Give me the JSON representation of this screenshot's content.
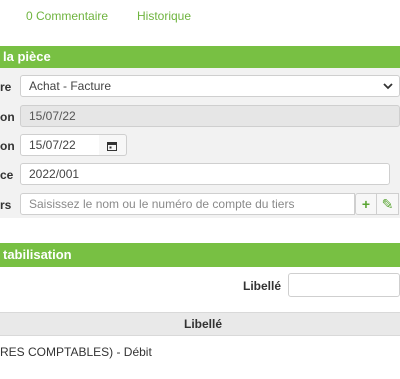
{
  "tabs": [
    {
      "label": "0 Commentaire"
    },
    {
      "label": "Historique"
    }
  ],
  "piece_section": {
    "title": "la pièce",
    "fields": {
      "type": {
        "label": "re",
        "value": "Achat - Facture"
      },
      "date_creation": {
        "label": "on",
        "value": "15/07/22"
      },
      "date_piece": {
        "label": "on",
        "value": "15/07/22"
      },
      "reference": {
        "label": "ce",
        "value": "2022/001"
      },
      "tiers": {
        "label": "rs",
        "placeholder": "Saisissez le nom ou le numéro de compte du tiers"
      }
    },
    "buttons": {
      "add": "+",
      "edit": "✎"
    }
  },
  "compta_section": {
    "title": "tabilisation",
    "libelle_label": "Libellé",
    "libelle_value": "",
    "table": {
      "columns": [
        "Libellé"
      ],
      "rows": [
        {
          "text": "RES COMPTABLES) - Débit"
        }
      ]
    }
  },
  "colors": {
    "accent": "#78c043",
    "link": "#6fb43f"
  }
}
